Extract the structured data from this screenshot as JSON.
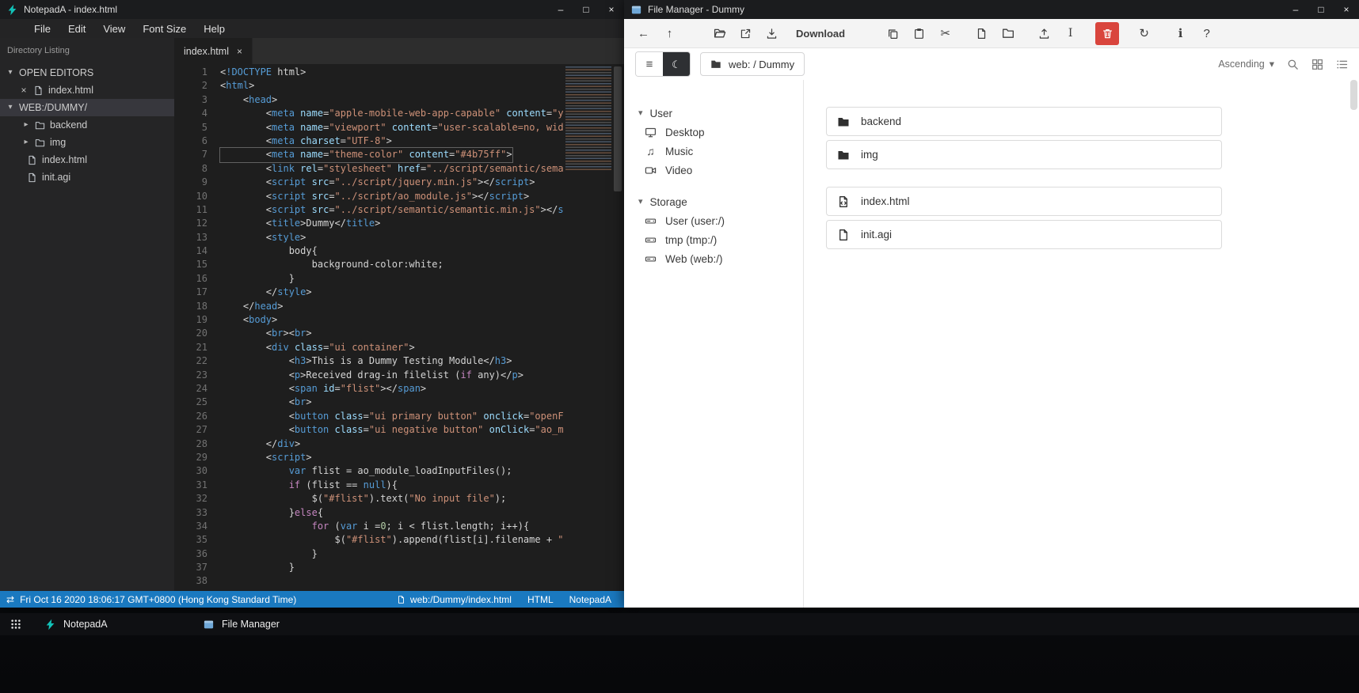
{
  "colors": {
    "accent_blue": "#1a79c0",
    "delete_red": "#d9453d",
    "notepad_teal": "#12c2b8",
    "fm_blue": "#6fa8d8"
  },
  "icons": {
    "minimize": "–",
    "maximize": "□",
    "close": "×",
    "caret_down": "▾",
    "caret_right": "▸",
    "back": "←",
    "up": "↑",
    "cut": "✂",
    "refresh": "↻",
    "info": "ℹ",
    "help": "?",
    "hamburger": "≡",
    "moon": "☾",
    "music": "♫",
    "swap": "⇄",
    "rename": "I"
  },
  "notepad": {
    "window_title": "NotepadA - index.html",
    "menu": [
      "File",
      "Edit",
      "View",
      "Font Size",
      "Help"
    ],
    "sidebar": {
      "header": "Directory Listing",
      "open_editors_label": "OPEN EDITORS",
      "open_editor_file": "index.html",
      "workspace_label": "WEB:/DUMMY/",
      "tree": [
        {
          "label": "backend",
          "type": "folder"
        },
        {
          "label": "img",
          "type": "folder"
        },
        {
          "label": "index.html",
          "type": "file"
        },
        {
          "label": "init.agi",
          "type": "file"
        }
      ]
    },
    "tab_label": "index.html",
    "editor": {
      "active_line": 7,
      "lines": [
        "<!DOCTYPE html>",
        "<html>",
        "    <head>",
        "        <meta name=\"apple-mobile-web-app-capable\" content=\"yes\">",
        "        <meta name=\"viewport\" content=\"user-scalable=no, width=device-width, initial-scale=1\">",
        "        <meta charset=\"UTF-8\">",
        "        <meta name=\"theme-color\" content=\"#4b75ff\">",
        "        <link rel=\"stylesheet\" href=\"../script/semantic/semantic.min.css\">",
        "        <script src=\"../script/jquery.min.js\"></script>",
        "        <script src=\"../script/ao_module.js\"></script>",
        "        <script src=\"../script/semantic/semantic.min.js\"></script>",
        "        <title>Dummy</title>",
        "        <style>",
        "            body{",
        "                background-color:white;",
        "            }",
        "        </style>",
        "    </head>",
        "    <body>",
        "        <br><br>",
        "        <div class=\"ui container\">",
        "            <h3>This is a Dummy Testing Module</h3>",
        "            <p>Received drag-in filelist (if any)</p>",
        "            <span id=\"flist\"></span>",
        "            <br>",
        "            <button class=\"ui primary button\" onclick=\"openFileSelector()\">",
        "            <button class=\"ui negative button\" onClick=\"ao_module_close()\">",
        "        </div>",
        "        <script>",
        "            var flist = ao_module_loadInputFiles();",
        "            if (flist == null){",
        "                $(\"#flist\").text(\"No input file\");",
        "            }else{",
        "                for (var i =0; i < flist.length; i++){",
        "                    $(\"#flist\").append(flist[i].filename + \"<br>\");",
        "                }",
        "            }",
        ""
      ]
    },
    "statusbar": {
      "datetime": "Fri Oct 16 2020 18:06:17 GMT+0800 (Hong Kong Standard Time)",
      "file_path": "web:/Dummy/index.html",
      "language": "HTML",
      "app_name": "NotepadA"
    }
  },
  "filemanager": {
    "window_title": "File Manager - Dummy",
    "download_label": "Download",
    "breadcrumb": "web: / Dummy",
    "sort_order": "Ascending",
    "sidebar": {
      "sections": [
        {
          "label": "User",
          "items": [
            {
              "label": "Desktop"
            },
            {
              "label": "Music"
            },
            {
              "label": "Video"
            }
          ]
        },
        {
          "label": "Storage",
          "items": [
            {
              "label": "User (user:/)"
            },
            {
              "label": "tmp (tmp:/)"
            },
            {
              "label": "Web (web:/)"
            }
          ]
        }
      ]
    },
    "files": [
      {
        "name": "backend",
        "type": "folder"
      },
      {
        "name": "img",
        "type": "folder"
      },
      {
        "name": "index.html",
        "type": "file-code"
      },
      {
        "name": "init.agi",
        "type": "file"
      }
    ]
  },
  "taskbar": {
    "items": [
      {
        "label": "NotepadA"
      },
      {
        "label": "File Manager"
      }
    ]
  }
}
